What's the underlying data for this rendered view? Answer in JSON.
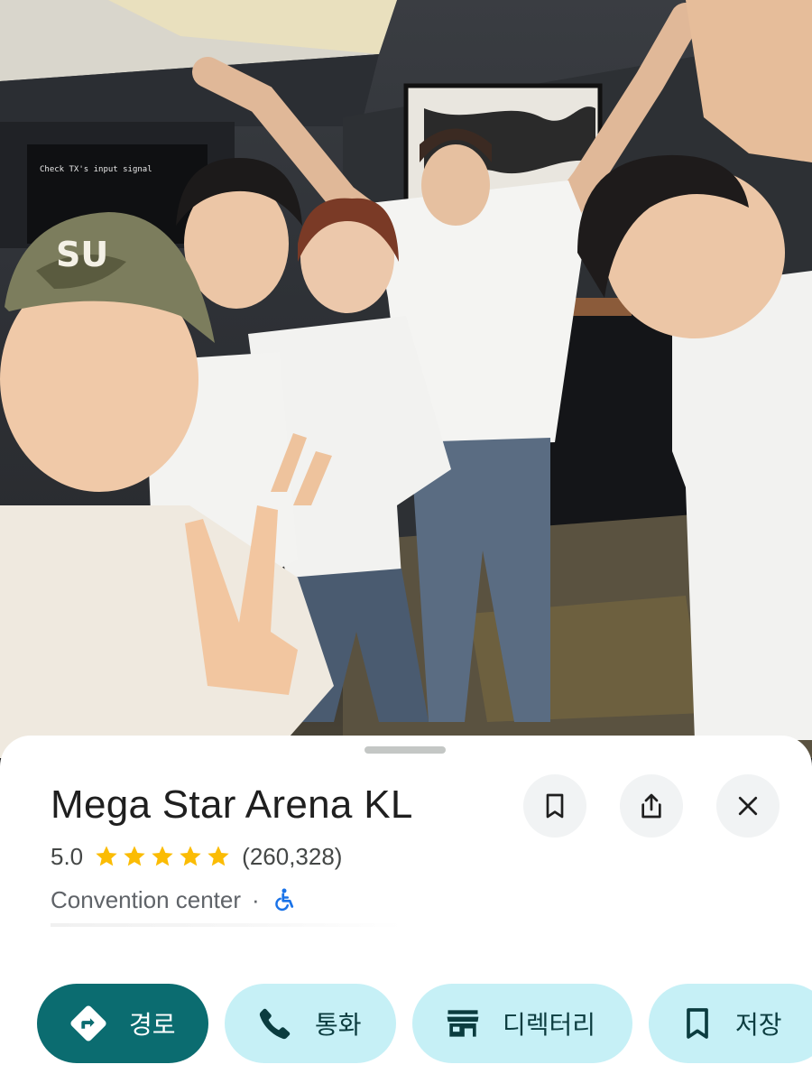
{
  "place": {
    "name": "Mega Star Arena KL",
    "rating": "5.0",
    "star_count": 5,
    "review_count": "(260,328)",
    "category": "Convention center",
    "separator": "·"
  },
  "header_actions": [
    {
      "icon": "bookmark-icon"
    },
    {
      "icon": "share-icon"
    },
    {
      "icon": "close-icon"
    }
  ],
  "actions": {
    "directions": {
      "label": "경로",
      "icon": "directions-icon"
    },
    "call": {
      "label": "통화",
      "icon": "phone-icon"
    },
    "directory": {
      "label": "디렉터리",
      "icon": "storefront-icon"
    },
    "save": {
      "label": "저장",
      "icon": "bookmark-icon"
    }
  },
  "photo": {
    "monitor_text": "Check TX's input signal",
    "cap_text": "SU"
  },
  "colors": {
    "primary": "#0b6c70",
    "tonal": "#c6f0f6",
    "star": "#fbbc04",
    "accessibility": "#1a73e8"
  }
}
